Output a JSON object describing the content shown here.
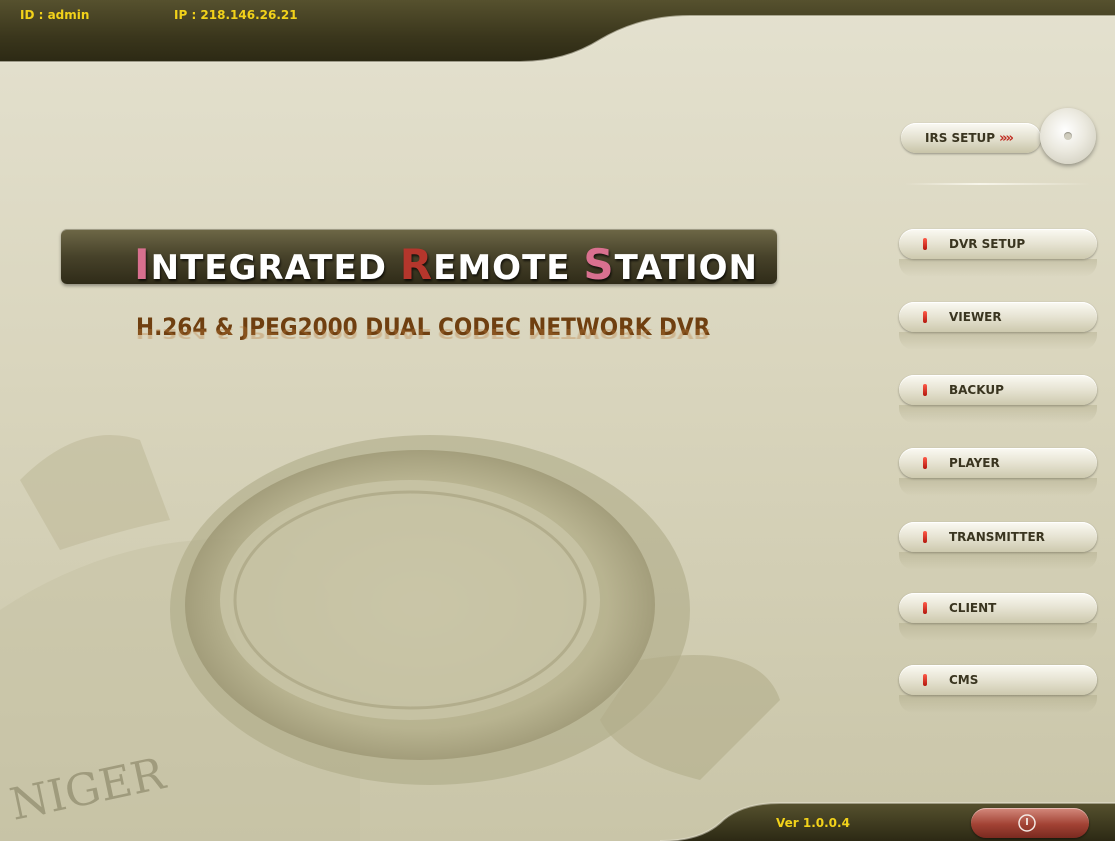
{
  "header": {
    "id_text": "ID : admin",
    "ip_text": "IP : 218.146.26.21"
  },
  "title": {
    "part1_cap": "I",
    "part1_rest": "NTEGRATED ",
    "part2_cap": "R",
    "part2_rest": "EMOTE ",
    "part3_cap": "S",
    "part3_rest": "TATION"
  },
  "subtitle": "H.264 & JPEG2000 DUAL CODEC NETWORK DVR",
  "background_text": "NIGER",
  "irs_setup": {
    "label": "IRS SETUP",
    "arrows": "»»"
  },
  "menu": [
    {
      "label": "DVR SETUP"
    },
    {
      "label": "VIEWER"
    },
    {
      "label": "BACKUP"
    },
    {
      "label": "PLAYER"
    },
    {
      "label": "TRANSMITTER"
    },
    {
      "label": "CLIENT"
    },
    {
      "label": "CMS"
    }
  ],
  "footer": {
    "version": "Ver 1.0.0.4"
  },
  "colors": {
    "bar_dark": "#3d3820",
    "info_text": "#f2d21a",
    "accent_red": "#b5362c",
    "accent_pink": "#d9708f",
    "subtitle": "#6f3f10"
  },
  "icons": {
    "power": "power-icon",
    "led": "led-indicator-icon"
  }
}
